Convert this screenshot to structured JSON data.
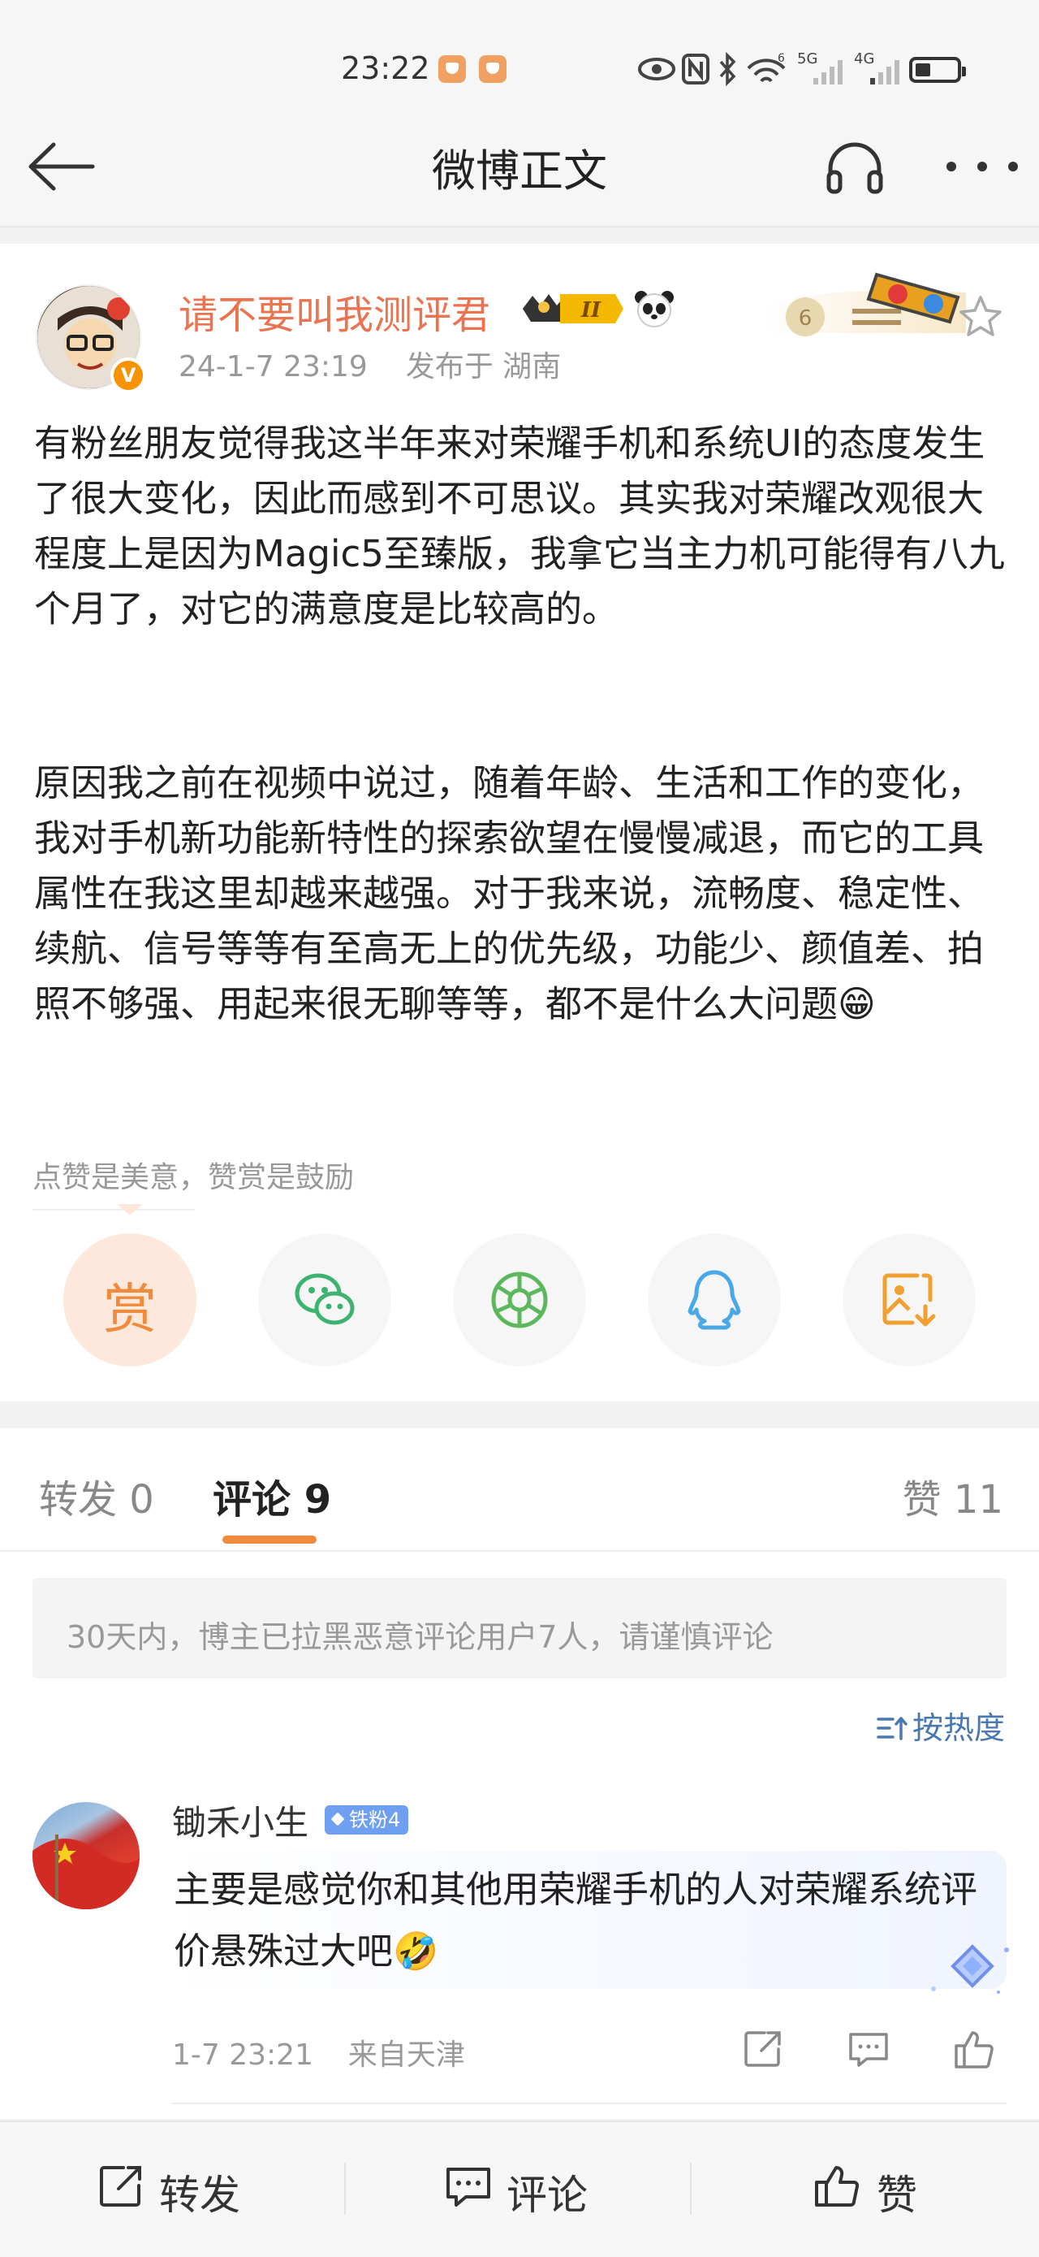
{
  "status_bar": {
    "time": "23:22",
    "network_5g": "5G",
    "network_4g": "4G"
  },
  "navbar": {
    "title": "微博正文"
  },
  "post": {
    "author": "请不要叫我测评君",
    "level_badge": "II",
    "date": "24-1-7 23:19",
    "location": "发布于 湖南",
    "paragraph1": "有粉丝朋友觉得我这半年来对荣耀手机和系统UI的态度发生了很大变化，因此而感到不可思议。其实我对荣耀改观很大程度上是因为Magic5至臻版，我拿它当主力机可能得有八九个月了，对它的满意度是比较高的。",
    "paragraph2": "原因我之前在视频中说过，随着年龄、生活和工作的变化，我对手机新功能新特性的探索欲望在慢慢减退，而它的工具属性在我这里却越来越强。对于我来说，流畅度、稳定性、续航、信号等等有至高无上的优先级，功能少、颜值差、拍照不够强、用起来很无聊等等，都不是什么大问题😁",
    "reward_hint": "点赞是美意，赞赏是鼓励",
    "reward_label": "赏"
  },
  "tabs": {
    "repost": "转发 0",
    "comment": "评论 9",
    "like": "赞 11"
  },
  "notice": "30天内，博主已拉黑恶意评论用户7人，请谨慎评论",
  "sort_label": "按热度",
  "comment": {
    "user": "锄禾小生",
    "fan_badge": "铁粉4",
    "text": "主要是感觉你和其他用荣耀手机的人对荣耀系统评价悬殊过大吧🤣",
    "date": "1-7 23:21",
    "source": "来自天津"
  },
  "bottom_bar": {
    "repost": "转发",
    "comment": "评论",
    "like": "赞"
  },
  "colors": {
    "accent": "#eb7350",
    "orange": "#f08a3c",
    "link": "#4a78b0"
  }
}
